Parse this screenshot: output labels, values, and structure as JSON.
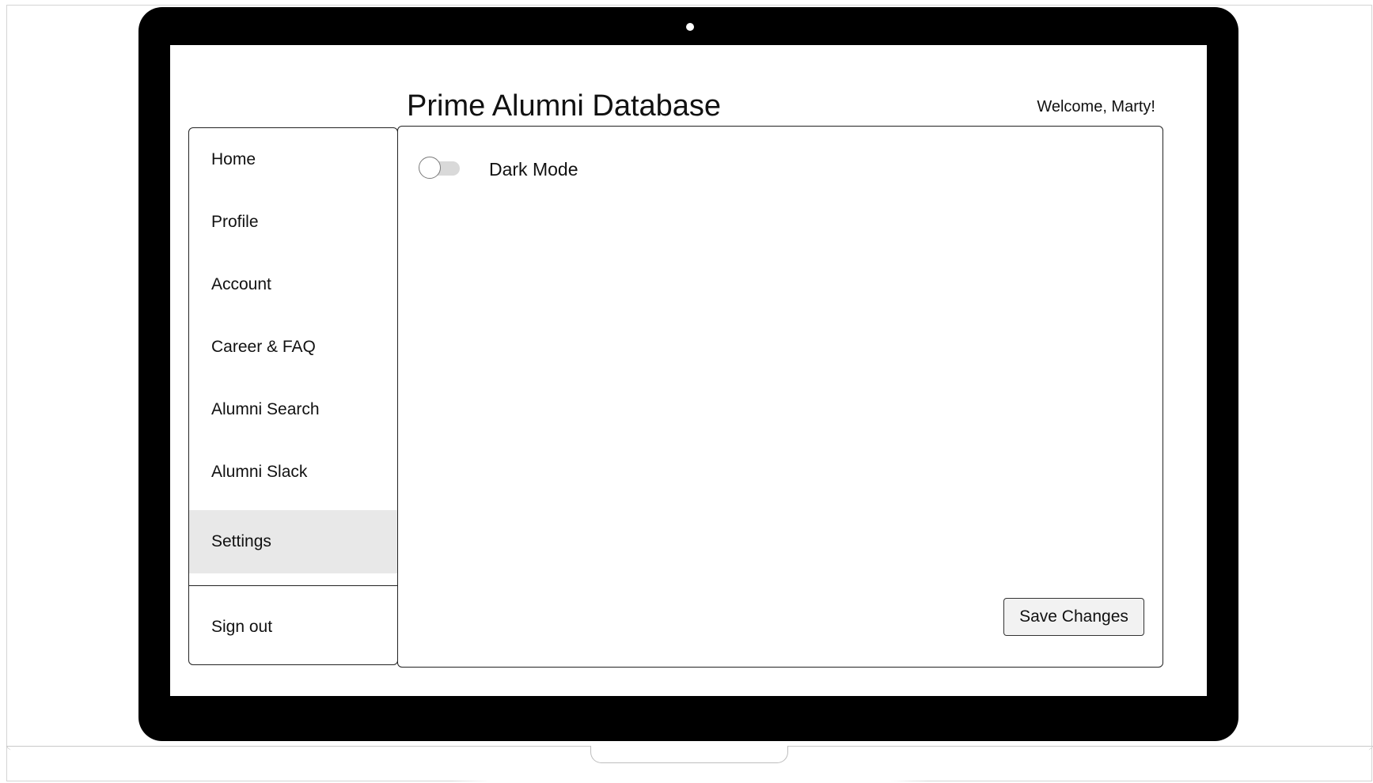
{
  "header": {
    "title": "Prime Alumni Database",
    "welcome": "Welcome, Marty!"
  },
  "sidebar": {
    "items": [
      {
        "label": "Home",
        "active": false
      },
      {
        "label": "Profile",
        "active": false
      },
      {
        "label": "Account",
        "active": false
      },
      {
        "label": "Career & FAQ",
        "active": false
      },
      {
        "label": "Alumni Search",
        "active": false
      },
      {
        "label": "Alumni Slack",
        "active": false
      },
      {
        "label": "Settings",
        "active": true
      }
    ],
    "sign_out": "Sign out"
  },
  "settings": {
    "dark_mode_label": "Dark Mode",
    "dark_mode_enabled": false,
    "save_label": "Save Changes"
  },
  "colors": {
    "bezel": "#000000",
    "active_nav_background": "#e8e8e8",
    "toggle_track": "#d9d9d9",
    "button_background": "#f2f2f2"
  }
}
